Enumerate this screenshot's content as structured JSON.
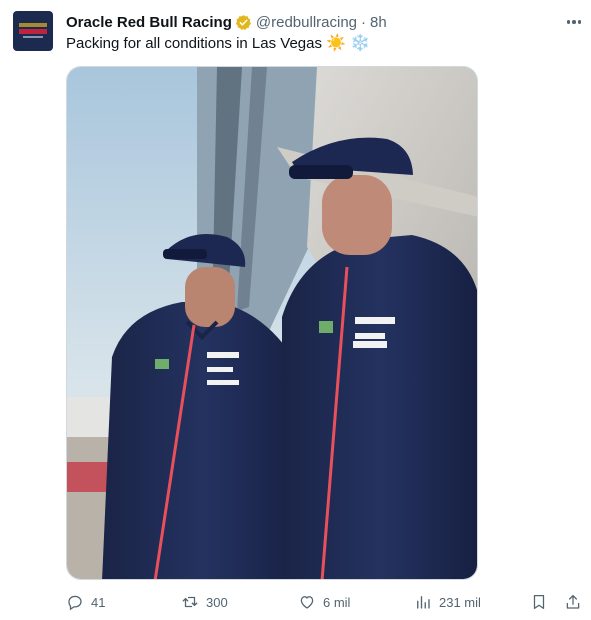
{
  "author": {
    "name": "Oracle Red Bull Racing",
    "handle": "@redbullracing",
    "separator": "·",
    "time": "8h"
  },
  "tweet": {
    "text": "Packing for all conditions in Las Vegas",
    "emoji_sun": "☀️",
    "emoji_snow": "❄️"
  },
  "actions": {
    "replies": "41",
    "retweets": "300",
    "likes": "6 mil",
    "views": "231 mil"
  },
  "icons": {
    "verified": "verified-badge-icon",
    "more": "more-dots-icon",
    "reply": "reply-icon",
    "retweet": "retweet-icon",
    "like": "heart-icon",
    "views": "views-chart-icon",
    "bookmark": "bookmark-icon",
    "share": "share-icon"
  },
  "colors": {
    "verified_badge": "#e2b719",
    "secondary_text": "#536471",
    "primary_text": "#0f1419",
    "jacket_navy": "#1e2a4f",
    "zip_accent": "#e8505b"
  }
}
